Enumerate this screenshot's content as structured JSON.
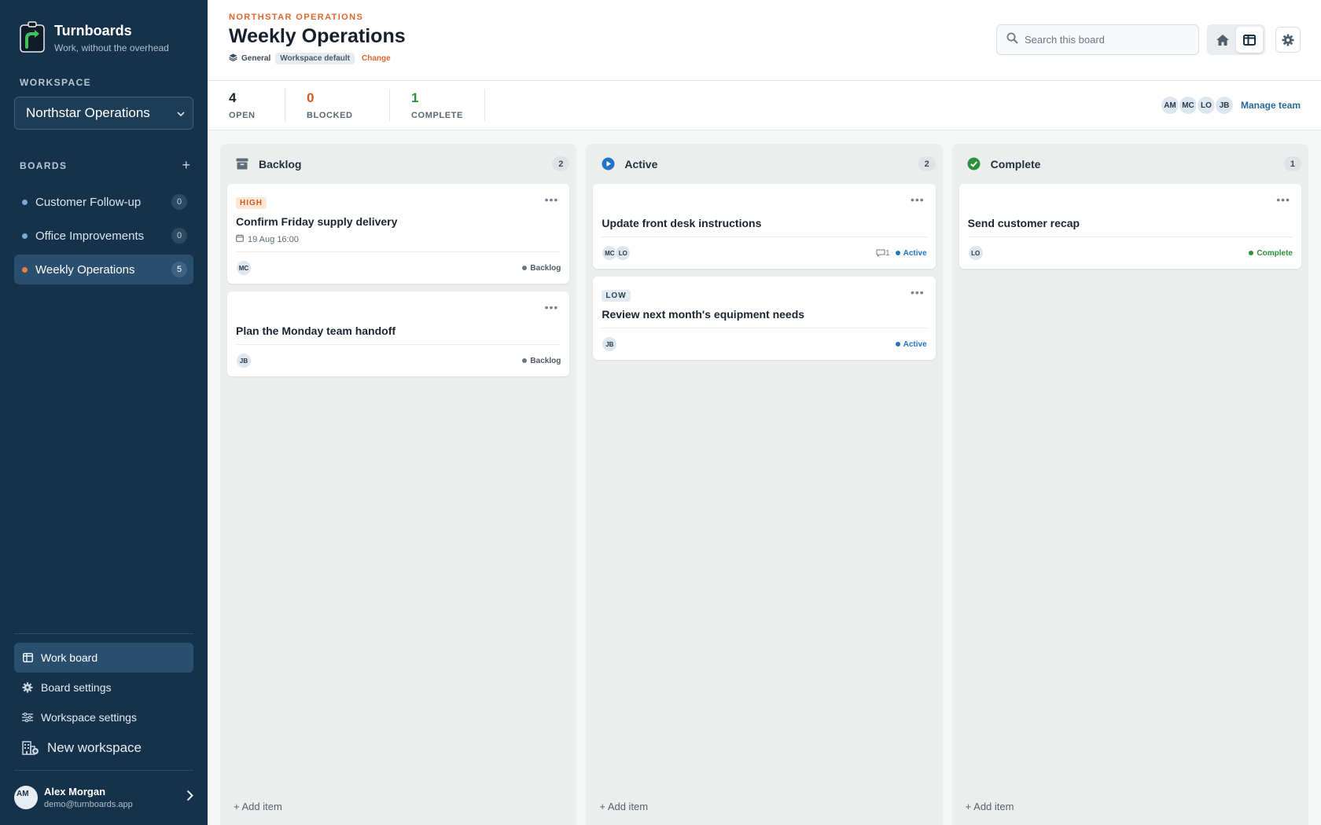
{
  "brand": {
    "name": "Turnboards",
    "tagline": "Work, without the overhead"
  },
  "sidebar": {
    "workspace_label": "WORKSPACE",
    "workspace_selected": "Northstar Operations",
    "boards_label": "BOARDS",
    "boards": [
      {
        "label": "Customer Follow-up",
        "count": "0"
      },
      {
        "label": "Office Improvements",
        "count": "0"
      },
      {
        "label": "Weekly Operations",
        "count": "5"
      }
    ],
    "nav": [
      {
        "label": "Work board",
        "icon": "board-icon"
      },
      {
        "label": "Board settings",
        "icon": "gear-icon"
      },
      {
        "label": "Workspace settings",
        "icon": "sliders-icon"
      },
      {
        "label": "New workspace",
        "icon": "building-plus-icon"
      }
    ],
    "user": {
      "initials": "AM",
      "name": "Alex Morgan",
      "email": "demo@turnboards.app"
    }
  },
  "header": {
    "org": "NORTHSTAR OPERATIONS",
    "title": "Weekly Operations",
    "category": "General",
    "category_badge": "Workspace default",
    "change_label": "Change",
    "search_placeholder": "Search this board"
  },
  "stats": [
    {
      "value": "4",
      "label": "OPEN",
      "color": "#1b2430"
    },
    {
      "value": "0",
      "label": "BLOCKED",
      "color": "#d35a1e"
    },
    {
      "value": "1",
      "label": "COMPLETE",
      "color": "#2e8f3d"
    }
  ],
  "team": {
    "members": [
      "AM",
      "MC",
      "LO",
      "JB"
    ],
    "manage_label": "Manage team"
  },
  "columns": [
    {
      "title": "Backlog",
      "count": "2",
      "add_label": "+ Add item",
      "cards": [
        {
          "priority": "HIGH",
          "title": "Confirm Friday supply delivery",
          "date": "19 Aug 16:00",
          "people": [
            "MC"
          ],
          "status": "Backlog"
        },
        {
          "title": "Plan the Monday team handoff",
          "people": [
            "JB"
          ],
          "status": "Backlog"
        }
      ]
    },
    {
      "title": "Active",
      "count": "2",
      "add_label": "+ Add item",
      "cards": [
        {
          "title": "Update front desk instructions",
          "people": [
            "MC",
            "LO"
          ],
          "comments": "1",
          "status": "Active"
        },
        {
          "priority": "LOW",
          "title": "Review next month's equipment needs",
          "people": [
            "JB"
          ],
          "status": "Active"
        }
      ]
    },
    {
      "title": "Complete",
      "count": "1",
      "add_label": "+ Add item",
      "cards": [
        {
          "title": "Send customer recap",
          "people": [
            "LO"
          ],
          "status": "Complete"
        }
      ]
    }
  ],
  "colors": {
    "sidebar": "#15324a",
    "accent": "#e0662e",
    "active": "#2274c7",
    "complete": "#2e8f3d"
  }
}
